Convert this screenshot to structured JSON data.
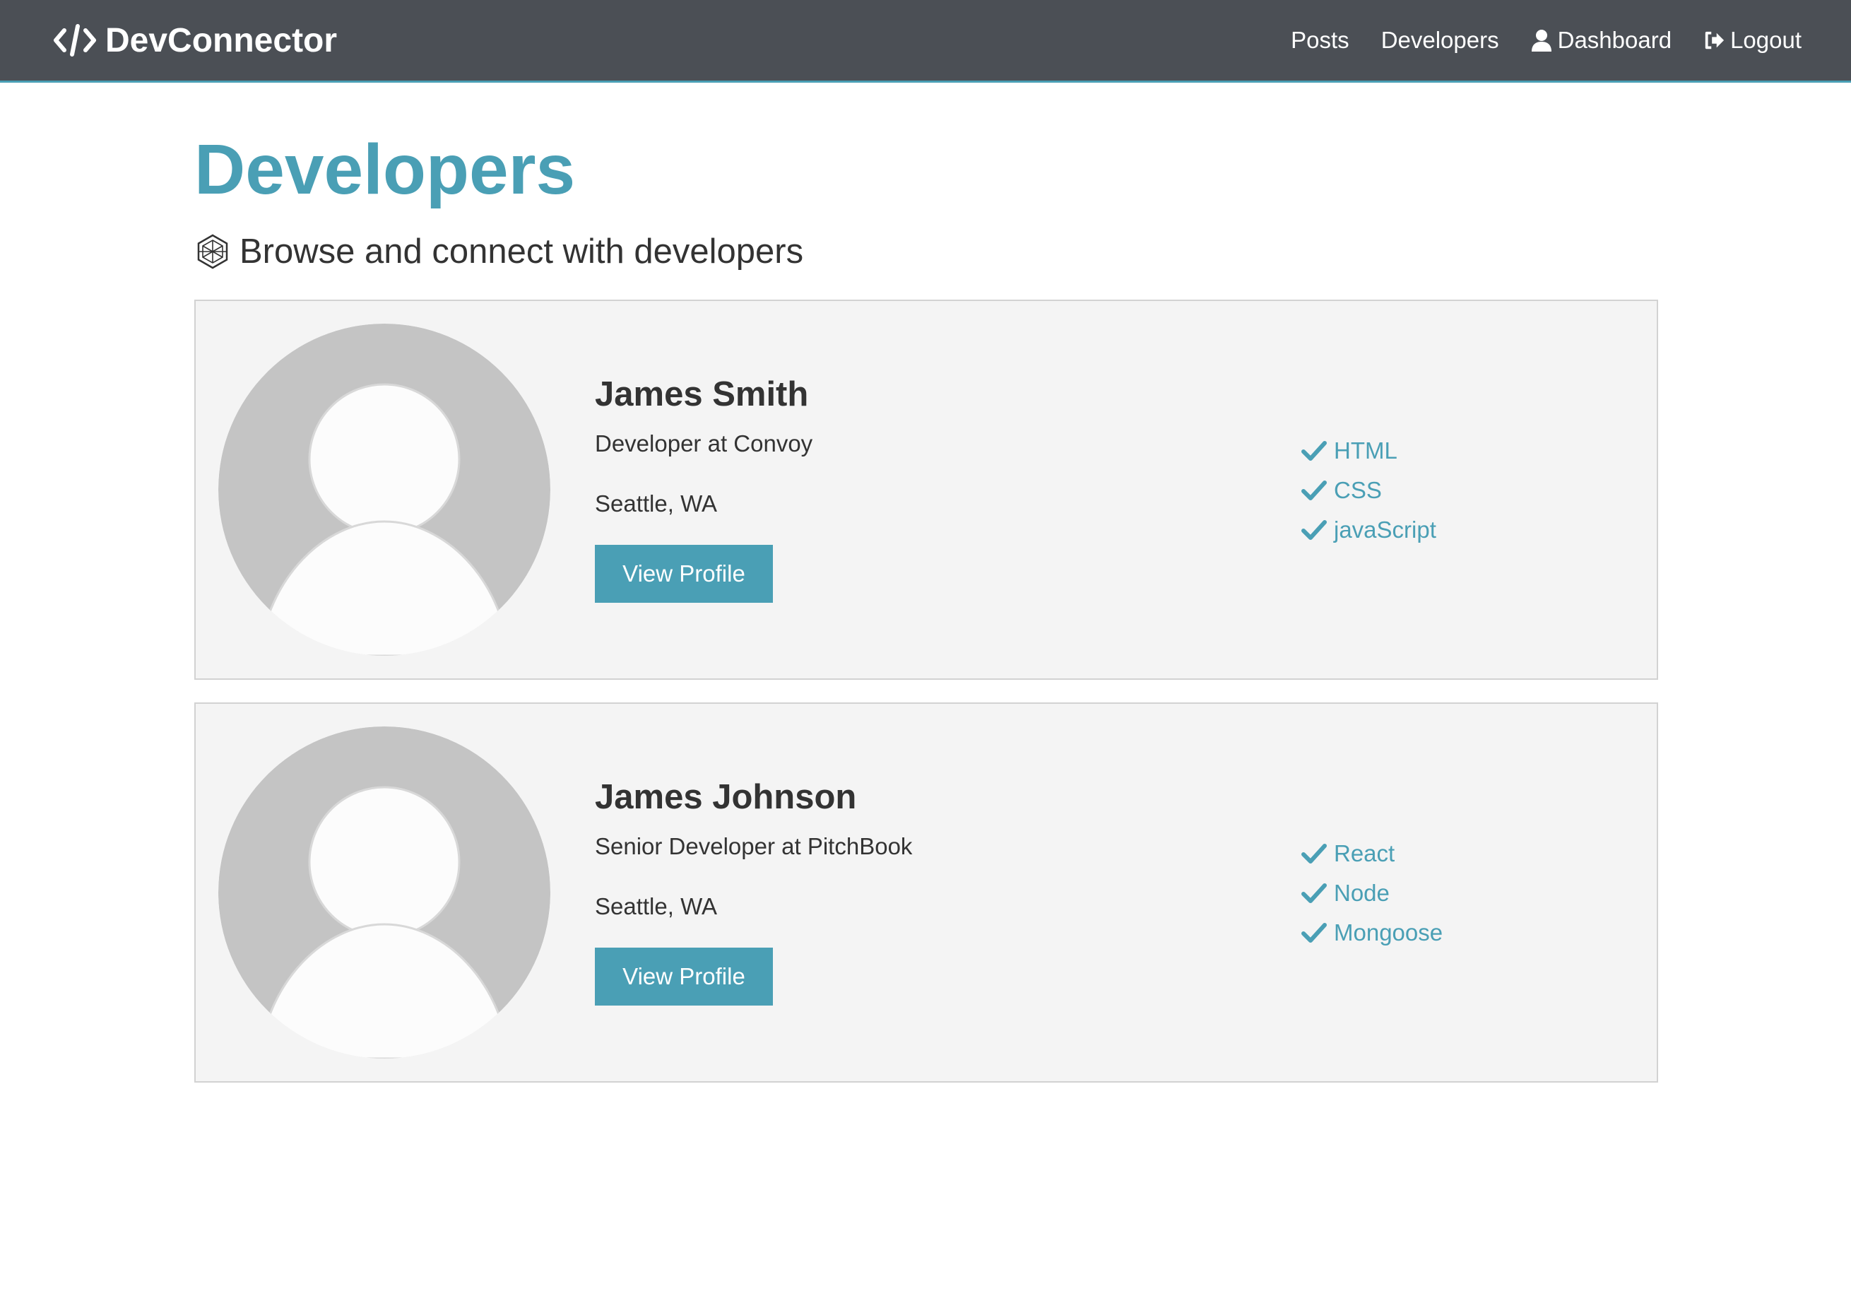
{
  "navbar": {
    "brand": "DevConnector",
    "links": [
      {
        "label": "Posts",
        "icon": "none"
      },
      {
        "label": "Developers",
        "icon": "none"
      },
      {
        "label": "Dashboard",
        "icon": "user-icon"
      },
      {
        "label": "Logout",
        "icon": "sign-out-icon"
      }
    ],
    "colors": {
      "background": "#4b4f55",
      "accent": "#4a9fb5"
    }
  },
  "page": {
    "title": "Developers",
    "lead": "Browse and connect with developers",
    "lead_icon": "connect-develop-icon"
  },
  "profiles": [
    {
      "name": "James Smith",
      "status": "Developer at Convoy",
      "location": "Seattle, WA",
      "button_label": "View Profile",
      "skills": [
        "HTML",
        "CSS",
        "javaScript"
      ]
    },
    {
      "name": "James Johnson",
      "status": "Senior Developer at PitchBook",
      "location": "Seattle, WA",
      "button_label": "View Profile",
      "skills": [
        "React",
        "Node",
        "Mongoose"
      ]
    }
  ]
}
